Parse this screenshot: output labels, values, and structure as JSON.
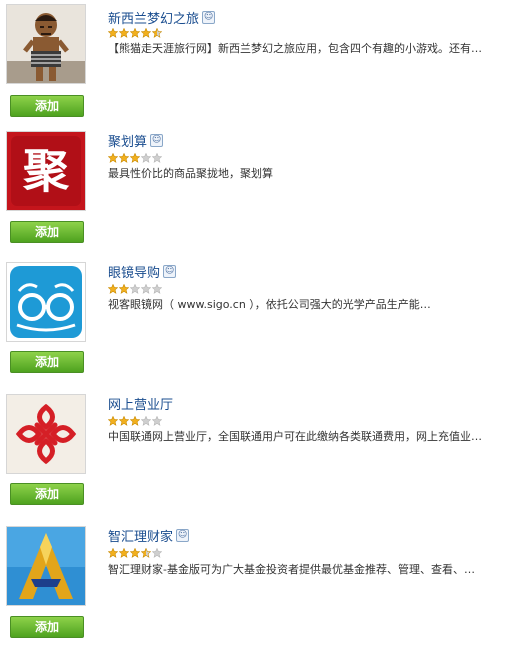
{
  "apps": [
    {
      "title": "新西兰梦幻之旅",
      "badge": "☺",
      "rating": 4.5,
      "description": "【熊猫走天涯旅行网】新西兰梦幻之旅应用，包含四个有趣的小游戏。还有…",
      "button_label": "添加",
      "icon": "maori-warrior-icon"
    },
    {
      "title": "聚划算",
      "badge": "☺",
      "rating": 3,
      "description": "最具性价比的商品聚拢地，聚划算",
      "button_label": "添加",
      "icon": "ju-character-icon",
      "icon_text": "聚"
    },
    {
      "title": "眼镜导购",
      "badge": "☺",
      "rating": 2,
      "description": "视客眼镜网（ www.sigo.cn ），依托公司强大的光学产品生产能…",
      "button_label": "添加",
      "icon": "glasses-icon"
    },
    {
      "title": "网上营业厅",
      "badge": "☺",
      "rating": 3,
      "description": "中国联通网上营业厅，全国联通用户可在此缴纳各类联通费用，网上充值业…",
      "button_label": "添加",
      "icon": "china-unicom-knot-icon"
    },
    {
      "title": "智汇理财家",
      "badge": "☺",
      "rating": 3.5,
      "description": "智汇理财家-基金版可为广大基金投资者提供最优基金推荐、管理、查看、…",
      "button_label": "添加",
      "icon": "golden-a-logo-icon"
    }
  ],
  "colors": {
    "title": "#1a4d8f",
    "button": "#5db12a",
    "star_on": "#f2b01e",
    "star_off": "#cfcfcf"
  }
}
